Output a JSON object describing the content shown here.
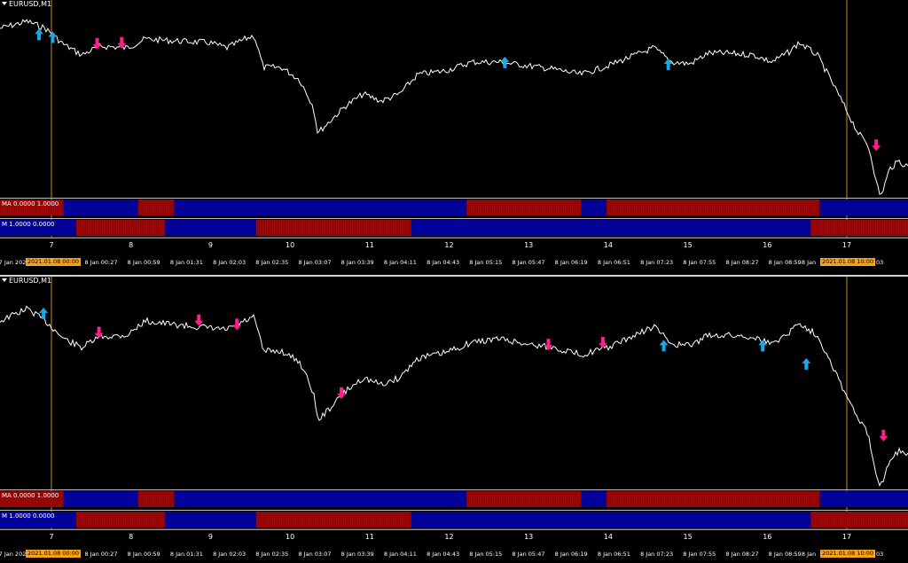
{
  "colors": {
    "background": "#000000",
    "price_line": "#ffffff",
    "up_arrow": "#1aa7e6",
    "down_arrow": "#ff1f8a",
    "ma_red": "#b00000",
    "ma_blue": "#0000b8",
    "cursor_line": "#c98b2a",
    "separator": "#c9d4de"
  },
  "panels": [
    {
      "id": "top",
      "symbol_title": "EURUSD,M1",
      "indicators": [
        {
          "label": "MA 0.0000 1.0000",
          "segments": [
            [
              "red",
              0,
              0.07
            ],
            [
              "blue",
              0.07,
              0.152
            ],
            [
              "red",
              0.152,
              0.192
            ],
            [
              "blue",
              0.192,
              0.514
            ],
            [
              "red",
              0.514,
              0.64
            ],
            [
              "blue",
              0.64,
              0.668
            ],
            [
              "red",
              0.668,
              0.903
            ],
            [
              "blue",
              0.903,
              1.0
            ],
            [
              "red",
              1.0,
              1.0
            ]
          ]
        },
        {
          "label": "M 1.0000 0.0000",
          "segments": [
            [
              "blue",
              0,
              0.084
            ],
            [
              "red",
              0.084,
              0.182
            ],
            [
              "blue",
              0.182,
              0.282
            ],
            [
              "red",
              0.282,
              0.453
            ],
            [
              "blue",
              0.453,
              0.893
            ],
            [
              "red",
              0.893,
              1.0
            ]
          ]
        }
      ],
      "numbers": [
        "7",
        "8",
        "9",
        "10",
        "11",
        "12",
        "13",
        "14",
        "15",
        "16",
        "17"
      ],
      "time_labels": [
        "8 Jan 00:27",
        "8 Jan 00:59",
        "8 Jan 01:31",
        "8 Jan 02:03",
        "8 Jan 02:35",
        "8 Jan 03:07",
        "8 Jan 03:39",
        "8 Jan 04:11",
        "8 Jan 04:43",
        "8 Jan 05:15",
        "8 Jan 05:47",
        "8 Jan 06:19",
        "8 Jan 06:51",
        "8 Jan 07:23",
        "8 Jan 07:55",
        "8 Jan 08:27",
        "8 Jan 08:59"
      ],
      "left_label": "7 Jan 202",
      "cursor_left": "2021.01.08 00:00",
      "cursor_right": "2021.01.08 10:00",
      "right_label": "8 Jan",
      "right_end": ":03",
      "up_arrows": [
        [
          0.043,
          0.14
        ],
        [
          0.058,
          0.155
        ],
        [
          0.556,
          0.29
        ],
        [
          0.736,
          0.3
        ]
      ],
      "down_arrows": [
        [
          0.107,
          0.185
        ],
        [
          0.134,
          0.18
        ],
        [
          0.965,
          0.73
        ]
      ]
    },
    {
      "id": "bottom",
      "symbol_title": "EURUSD,M1",
      "indicators": [
        {
          "label": "MA 0.0000 1.0000",
          "segments": [
            [
              "red",
              0,
              0.07
            ],
            [
              "blue",
              0.07,
              0.152
            ],
            [
              "red",
              0.152,
              0.192
            ],
            [
              "blue",
              0.192,
              0.514
            ],
            [
              "red",
              0.514,
              0.64
            ],
            [
              "blue",
              0.64,
              0.668
            ],
            [
              "red",
              0.668,
              0.903
            ],
            [
              "blue",
              0.903,
              1.0
            ],
            [
              "red",
              1.0,
              1.0
            ]
          ]
        },
        {
          "label": "M 1.0000 0.0000",
          "segments": [
            [
              "blue",
              0,
              0.084
            ],
            [
              "red",
              0.084,
              0.182
            ],
            [
              "blue",
              0.182,
              0.282
            ],
            [
              "red",
              0.282,
              0.453
            ],
            [
              "blue",
              0.453,
              0.893
            ],
            [
              "red",
              0.893,
              1.0
            ]
          ]
        }
      ],
      "numbers": [
        "7",
        "8",
        "9",
        "10",
        "11",
        "12",
        "13",
        "14",
        "15",
        "16",
        "17"
      ],
      "time_labels": [
        "8 Jan 00:27",
        "8 Jan 00:59",
        "8 Jan 01:31",
        "8 Jan 02:03",
        "8 Jan 02:35",
        "8 Jan 03:07",
        "8 Jan 03:39",
        "8 Jan 04:11",
        "8 Jan 04:43",
        "8 Jan 05:15",
        "8 Jan 05:47",
        "8 Jan 06:19",
        "8 Jan 06:51",
        "8 Jan 07:23",
        "8 Jan 07:55",
        "8 Jan 08:27",
        "8 Jan 08:59"
      ],
      "left_label": "7 Jan 202",
      "cursor_left": "2021.01.08 00:00",
      "cursor_right": "2021.01.08 10:00",
      "right_label": "8 Jan",
      "right_end": ":03",
      "up_arrows": [
        [
          0.048,
          0.14
        ],
        [
          0.731,
          0.3
        ],
        [
          0.84,
          0.3
        ],
        [
          0.888,
          0.39
        ]
      ],
      "down_arrows": [
        [
          0.109,
          0.23
        ],
        [
          0.219,
          0.17
        ],
        [
          0.261,
          0.19
        ],
        [
          0.376,
          0.53
        ],
        [
          0.604,
          0.29
        ],
        [
          0.664,
          0.28
        ],
        [
          0.973,
          0.74
        ]
      ]
    }
  ]
}
